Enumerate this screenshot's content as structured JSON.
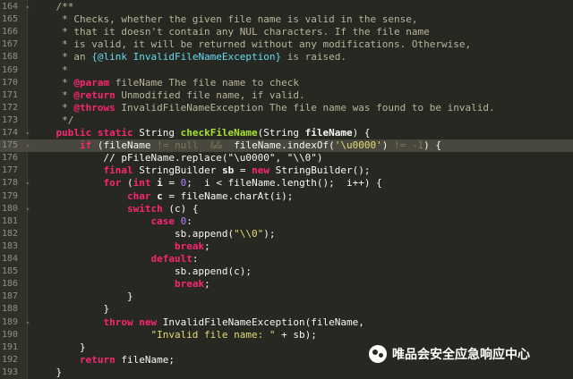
{
  "editor": {
    "lines": [
      {
        "n": "164",
        "segs": [
          [
            "c",
            "    /**"
          ]
        ]
      },
      {
        "n": "165",
        "segs": [
          [
            "c",
            "     * Checks, whether the given file name is valid in the sense,"
          ]
        ]
      },
      {
        "n": "166",
        "segs": [
          [
            "c",
            "     * that it doesn't contain any NUL characters. If the file name"
          ]
        ]
      },
      {
        "n": "167",
        "segs": [
          [
            "c",
            "     * is valid, it will be returned without any modifications. Otherwise,"
          ]
        ]
      },
      {
        "n": "168",
        "segs": [
          [
            "c",
            "     * an "
          ],
          [
            "lk",
            "{@link InvalidFileNameException}"
          ],
          [
            "c",
            " is raised."
          ]
        ]
      },
      {
        "n": "169",
        "segs": [
          [
            "c",
            "     *"
          ]
        ]
      },
      {
        "n": "170",
        "segs": [
          [
            "c",
            "     * "
          ],
          [
            "tag",
            "@param"
          ],
          [
            "c",
            " fileName The file name to check"
          ]
        ]
      },
      {
        "n": "171",
        "segs": [
          [
            "c",
            "     * "
          ],
          [
            "tag",
            "@return"
          ],
          [
            "c",
            " Unmodified file name, if valid."
          ]
        ]
      },
      {
        "n": "172",
        "segs": [
          [
            "c",
            "     * "
          ],
          [
            "tag",
            "@throws"
          ],
          [
            "c",
            " InvalidFileNameException The file name was found to be invalid."
          ]
        ]
      },
      {
        "n": "173",
        "segs": [
          [
            "c",
            "     */"
          ]
        ]
      },
      {
        "n": "174",
        "segs": [
          [
            "t",
            "    "
          ],
          [
            "k",
            "public static"
          ],
          [
            "t",
            " String "
          ],
          [
            "f",
            "checkFileName"
          ],
          [
            "t",
            "(String "
          ],
          [
            "p",
            "fileName"
          ],
          [
            "t",
            ") {"
          ]
        ]
      },
      {
        "n": "175",
        "segs": [
          [
            "t",
            "        "
          ],
          [
            "k",
            "if"
          ],
          [
            "t",
            " (fileName "
          ],
          [
            "dim",
            "!= null"
          ],
          [
            "t",
            "  "
          ],
          [
            "dim",
            "&&"
          ],
          [
            "t",
            "  fileName.indexOf("
          ],
          [
            "s",
            "'\\u0000'"
          ],
          [
            "t",
            ") "
          ],
          [
            "dim",
            "!= -1"
          ],
          [
            "t",
            ") {"
          ]
        ],
        "current": true
      },
      {
        "n": "176",
        "segs": [
          [
            "t",
            "            // pFileName.replace(\"\\u0000\", \"\\\\0\")"
          ]
        ]
      },
      {
        "n": "177",
        "segs": [
          [
            "t",
            "            "
          ],
          [
            "k",
            "final"
          ],
          [
            "t",
            " StringBuilder "
          ],
          [
            "p",
            "sb"
          ],
          [
            "t",
            " = "
          ],
          [
            "k",
            "new"
          ],
          [
            "t",
            " StringBuilder();"
          ]
        ]
      },
      {
        "n": "178",
        "segs": [
          [
            "t",
            "            "
          ],
          [
            "k",
            "for"
          ],
          [
            "t",
            " ("
          ],
          [
            "k",
            "int"
          ],
          [
            "t",
            " "
          ],
          [
            "p",
            "i"
          ],
          [
            "t",
            " = "
          ],
          [
            "n",
            "0"
          ],
          [
            "t",
            ";  i < fileName.length();  i++) {"
          ]
        ]
      },
      {
        "n": "179",
        "segs": [
          [
            "t",
            "                "
          ],
          [
            "k",
            "char"
          ],
          [
            "t",
            " "
          ],
          [
            "p",
            "c"
          ],
          [
            "t",
            " = fileName.charAt(i);"
          ]
        ]
      },
      {
        "n": "180",
        "segs": [
          [
            "t",
            "                "
          ],
          [
            "k",
            "switch"
          ],
          [
            "t",
            " (c) {"
          ]
        ]
      },
      {
        "n": "181",
        "segs": [
          [
            "t",
            "                    "
          ],
          [
            "k",
            "case"
          ],
          [
            "t",
            " "
          ],
          [
            "n",
            "0"
          ],
          [
            "t",
            ":"
          ]
        ]
      },
      {
        "n": "182",
        "segs": [
          [
            "t",
            "                        sb.append("
          ],
          [
            "s",
            "\"\\\\0\""
          ],
          [
            "t",
            ");"
          ]
        ]
      },
      {
        "n": "183",
        "segs": [
          [
            "t",
            "                        "
          ],
          [
            "k",
            "break"
          ],
          [
            "t",
            ";"
          ]
        ]
      },
      {
        "n": "184",
        "segs": [
          [
            "t",
            "                    "
          ],
          [
            "k",
            "default"
          ],
          [
            "t",
            ":"
          ]
        ]
      },
      {
        "n": "185",
        "segs": [
          [
            "t",
            "                        sb.append(c);"
          ]
        ]
      },
      {
        "n": "186",
        "segs": [
          [
            "t",
            "                        "
          ],
          [
            "k",
            "break"
          ],
          [
            "t",
            ";"
          ]
        ]
      },
      {
        "n": "187",
        "segs": [
          [
            "t",
            "                }"
          ]
        ]
      },
      {
        "n": "188",
        "segs": [
          [
            "t",
            "            }"
          ]
        ]
      },
      {
        "n": "189",
        "segs": [
          [
            "t",
            "            "
          ],
          [
            "k",
            "throw new"
          ],
          [
            "t",
            " InvalidFileNameException(fileName,"
          ]
        ]
      },
      {
        "n": "190",
        "segs": [
          [
            "t",
            "                    "
          ],
          [
            "s",
            "\"Invalid file name: \""
          ],
          [
            "t",
            " + sb);"
          ]
        ]
      },
      {
        "n": "191",
        "segs": [
          [
            "t",
            "        }"
          ]
        ]
      },
      {
        "n": "192",
        "segs": [
          [
            "t",
            "        "
          ],
          [
            "k",
            "return"
          ],
          [
            "t",
            " fileName;"
          ]
        ]
      },
      {
        "n": "193",
        "segs": [
          [
            "t",
            "    }"
          ]
        ]
      }
    ]
  },
  "watermark": {
    "text": "唯品会安全应急响应中心",
    "icon": "wechat-icon"
  },
  "colors": {
    "background": "#272822",
    "keyword": "#f92672",
    "function": "#a6e22e",
    "string": "#e6db74",
    "comment": "#b8b59a"
  }
}
